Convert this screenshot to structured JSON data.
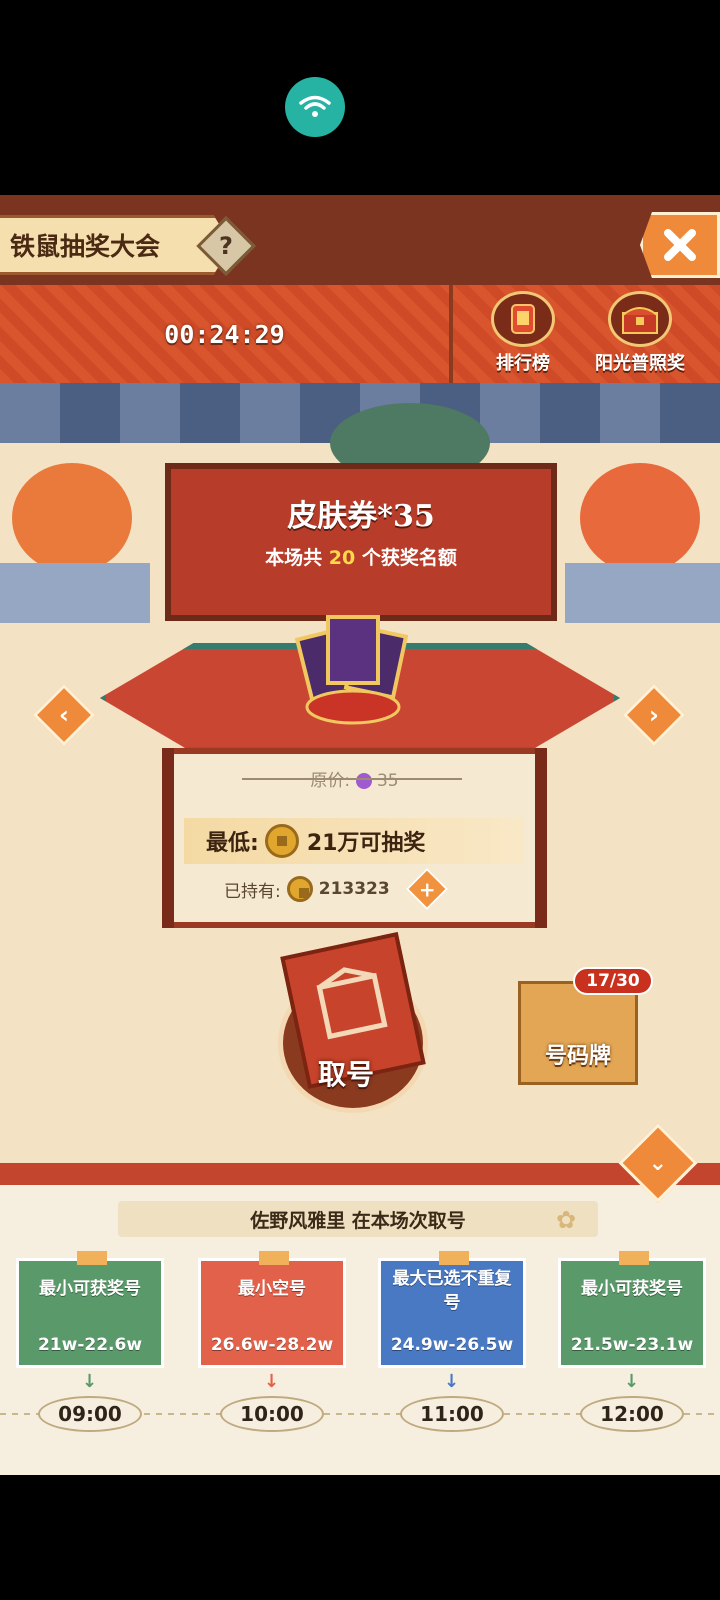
{
  "header": {
    "title": "铁鼠抽奖大会",
    "help": "?",
    "close": "✕"
  },
  "banner": {
    "timer": "00:24:29",
    "ranking_label": "排行榜",
    "sunshine_label": "阳光普照奖"
  },
  "prize": {
    "title": "皮肤券*35",
    "quota_prefix": "本场共",
    "quota_count": "20",
    "quota_suffix": "个获奖名额",
    "nav_prev": "‹",
    "nav_next": "›"
  },
  "price": {
    "original_label": "原价:",
    "original_value": "35",
    "min_label": "最低:",
    "min_value": "21万可抽奖",
    "held_label": "已持有:",
    "held_value": "213323",
    "plus": "+"
  },
  "actions": {
    "draw_label": "取号",
    "number_card_label": "号码牌",
    "number_card_count": "17/30"
  },
  "bottom": {
    "collapse": "⌄",
    "session_text": "佐野风雅里 在本场次取号",
    "cards": [
      {
        "line1": "最小可获奖号",
        "line2": "21w-22.6w",
        "time": "09:00",
        "color": "#5a9a6a",
        "arrow_color": "#5a9a6a"
      },
      {
        "line1": "最小空号",
        "line2": "26.6w-28.2w",
        "time": "10:00",
        "color": "#e2614a",
        "arrow_color": "#e2614a"
      },
      {
        "line1": "最大已选不重复号",
        "line2": "24.9w-26.5w",
        "time": "11:00",
        "color": "#4a79c4",
        "arrow_color": "#4a79c4"
      },
      {
        "line1": "最小可获奖号",
        "line2": "21.5w-23.1w",
        "time": "12:00",
        "color": "#5a9a6a",
        "arrow_color": "#5a9a6a"
      }
    ]
  }
}
